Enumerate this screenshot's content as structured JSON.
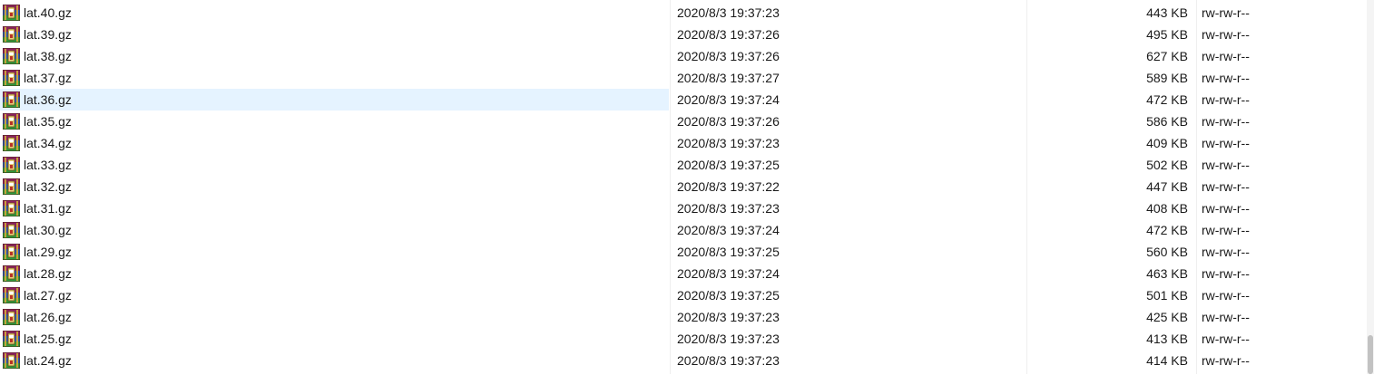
{
  "files": [
    {
      "name": "lat.40.gz",
      "modified": "2020/8/3 19:37:23",
      "size": "443 KB",
      "permissions": "rw-rw-r--",
      "selected": false,
      "icon": "archive-icon"
    },
    {
      "name": "lat.39.gz",
      "modified": "2020/8/3 19:37:26",
      "size": "495 KB",
      "permissions": "rw-rw-r--",
      "selected": false,
      "icon": "archive-icon"
    },
    {
      "name": "lat.38.gz",
      "modified": "2020/8/3 19:37:26",
      "size": "627 KB",
      "permissions": "rw-rw-r--",
      "selected": false,
      "icon": "archive-icon"
    },
    {
      "name": "lat.37.gz",
      "modified": "2020/8/3 19:37:27",
      "size": "589 KB",
      "permissions": "rw-rw-r--",
      "selected": false,
      "icon": "archive-icon"
    },
    {
      "name": "lat.36.gz",
      "modified": "2020/8/3 19:37:24",
      "size": "472 KB",
      "permissions": "rw-rw-r--",
      "selected": true,
      "icon": "archive-icon"
    },
    {
      "name": "lat.35.gz",
      "modified": "2020/8/3 19:37:26",
      "size": "586 KB",
      "permissions": "rw-rw-r--",
      "selected": false,
      "icon": "archive-icon"
    },
    {
      "name": "lat.34.gz",
      "modified": "2020/8/3 19:37:23",
      "size": "409 KB",
      "permissions": "rw-rw-r--",
      "selected": false,
      "icon": "archive-icon"
    },
    {
      "name": "lat.33.gz",
      "modified": "2020/8/3 19:37:25",
      "size": "502 KB",
      "permissions": "rw-rw-r--",
      "selected": false,
      "icon": "archive-icon"
    },
    {
      "name": "lat.32.gz",
      "modified": "2020/8/3 19:37:22",
      "size": "447 KB",
      "permissions": "rw-rw-r--",
      "selected": false,
      "icon": "archive-icon"
    },
    {
      "name": "lat.31.gz",
      "modified": "2020/8/3 19:37:23",
      "size": "408 KB",
      "permissions": "rw-rw-r--",
      "selected": false,
      "icon": "archive-icon"
    },
    {
      "name": "lat.30.gz",
      "modified": "2020/8/3 19:37:24",
      "size": "472 KB",
      "permissions": "rw-rw-r--",
      "selected": false,
      "icon": "archive-icon"
    },
    {
      "name": "lat.29.gz",
      "modified": "2020/8/3 19:37:25",
      "size": "560 KB",
      "permissions": "rw-rw-r--",
      "selected": false,
      "icon": "archive-icon"
    },
    {
      "name": "lat.28.gz",
      "modified": "2020/8/3 19:37:24",
      "size": "463 KB",
      "permissions": "rw-rw-r--",
      "selected": false,
      "icon": "archive-icon"
    },
    {
      "name": "lat.27.gz",
      "modified": "2020/8/3 19:37:25",
      "size": "501 KB",
      "permissions": "rw-rw-r--",
      "selected": false,
      "icon": "archive-icon"
    },
    {
      "name": "lat.26.gz",
      "modified": "2020/8/3 19:37:23",
      "size": "425 KB",
      "permissions": "rw-rw-r--",
      "selected": false,
      "icon": "archive-icon"
    },
    {
      "name": "lat.25.gz",
      "modified": "2020/8/3 19:37:23",
      "size": "413 KB",
      "permissions": "rw-rw-r--",
      "selected": false,
      "icon": "archive-icon"
    },
    {
      "name": "lat.24.gz",
      "modified": "2020/8/3 19:37:23",
      "size": "414 KB",
      "permissions": "rw-rw-r--",
      "selected": false,
      "icon": "archive-icon"
    }
  ],
  "colors": {
    "selection": "#e5f3ff",
    "divider": "#efefef",
    "scrollbar_track": "#f4f4f4",
    "scrollbar_thumb": "#c2c2c2"
  }
}
